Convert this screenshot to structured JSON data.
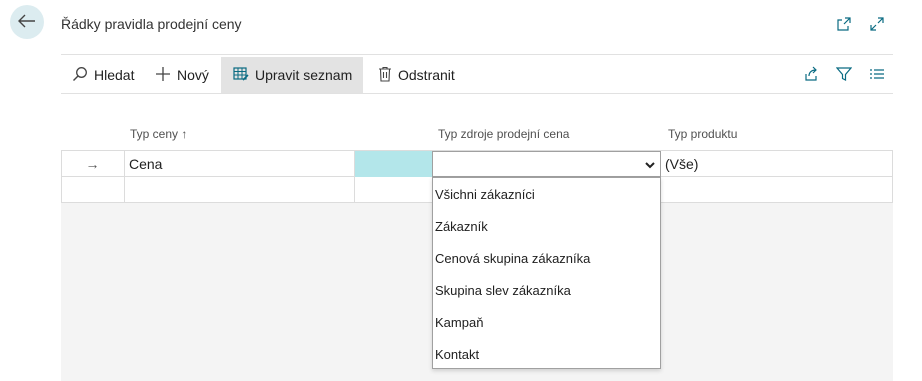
{
  "header": {
    "title": "Řádky pravidla prodejní ceny"
  },
  "toolbar": {
    "search_label": "Hledat",
    "new_label": "Nový",
    "edit_list_label": "Upravit seznam",
    "delete_label": "Odstranit"
  },
  "columns": {
    "price_type": "Typ ceny",
    "price_type_sort": "↑",
    "source_type": "Typ zdroje prodejní cena",
    "product_type": "Typ produktu"
  },
  "rows": [
    {
      "marker": "→",
      "price_type": "Cena",
      "source_type": "",
      "product_type": "(Vše)"
    },
    {
      "marker": "",
      "price_type": "",
      "source_type": "",
      "product_type": ""
    }
  ],
  "dropdown": {
    "options": [
      "Všichni zákazníci",
      "Zákazník",
      "Cenová skupina zákazníka",
      "Skupina slev zákazníka",
      "Kampaň",
      "Kontakt"
    ]
  },
  "colors": {
    "accent": "#0a6b82",
    "selected_cell": "#b3e6ea",
    "back_button_bg": "#dcecf0"
  },
  "icons": [
    "back-arrow-icon",
    "open-new-window-icon",
    "expand-icon",
    "search-icon",
    "plus-icon",
    "edit-list-icon",
    "trash-icon",
    "share-icon",
    "filter-icon",
    "list-view-icon",
    "row-arrow-icon",
    "chevron-down-icon"
  ]
}
